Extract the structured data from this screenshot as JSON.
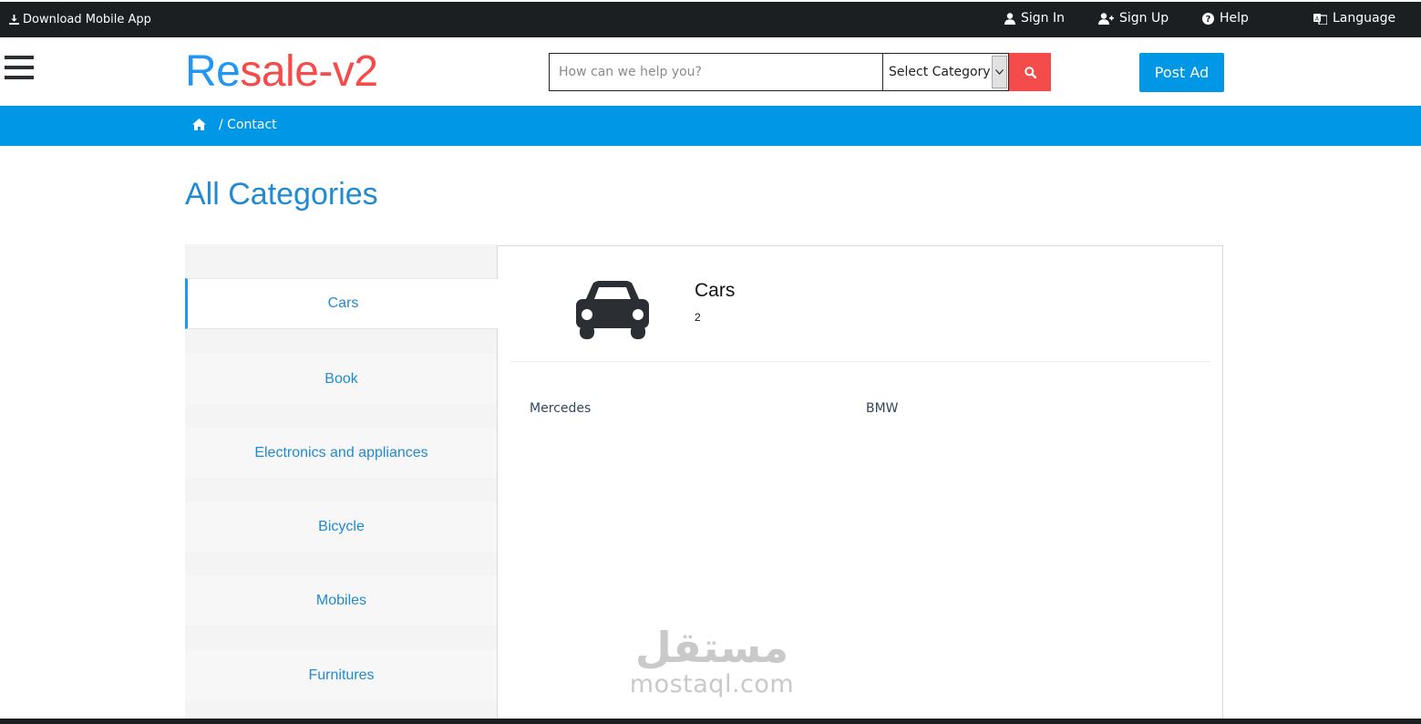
{
  "topbar": {
    "download_app": "Download Mobile App",
    "sign_in": "Sign In",
    "sign_up": "Sign Up",
    "help": "Help",
    "language": "Language"
  },
  "header": {
    "logo_first": "Re",
    "logo_rest": "sale-v2",
    "search_placeholder": "How can we help you?",
    "select_category": "Select Category",
    "post_ad": "Post Ad"
  },
  "breadcrumb": {
    "current": "/ Contact"
  },
  "page": {
    "title": "All Categories"
  },
  "categories": [
    {
      "label": "Cars",
      "active": true
    },
    {
      "label": "Book"
    },
    {
      "label": "Electronics and appliances"
    },
    {
      "label": "Bicycle"
    },
    {
      "label": "Mobiles"
    },
    {
      "label": "Furnitures"
    }
  ],
  "selected_category": {
    "name": "Cars",
    "count": "2",
    "icon": "car-icon",
    "subcategories": [
      "Mercedes",
      "BMW"
    ]
  },
  "watermark": {
    "arabic": "مستقل",
    "latin": "mostaql.com"
  },
  "colors": {
    "brand_blue": "#0097e6",
    "logo_blue": "#2196f3",
    "logo_red": "#f44b4b",
    "topbar_bg": "#1c1f22",
    "link_blue": "#1e8bd3"
  }
}
